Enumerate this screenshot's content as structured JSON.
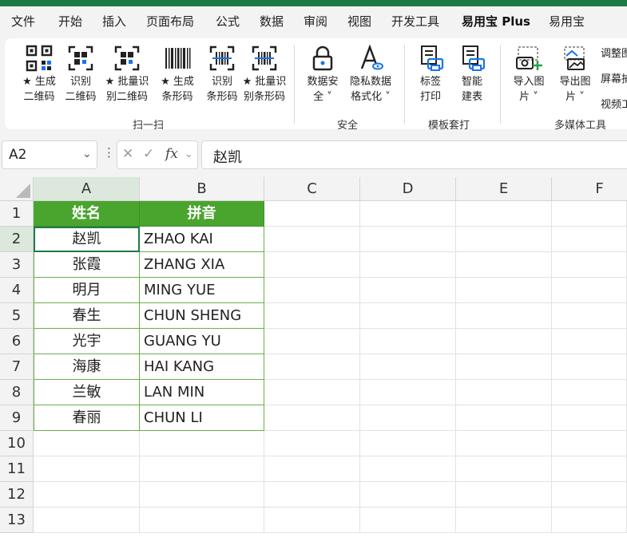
{
  "menu": {
    "items": [
      {
        "id": "file",
        "label": "文件"
      },
      {
        "id": "start",
        "label": "开始"
      },
      {
        "id": "insert",
        "label": "插入"
      },
      {
        "id": "layout",
        "label": "页面布局"
      },
      {
        "id": "formula",
        "label": "公式"
      },
      {
        "id": "data",
        "label": "数据"
      },
      {
        "id": "review",
        "label": "审阅"
      },
      {
        "id": "view",
        "label": "视图"
      },
      {
        "id": "dev",
        "label": "开发工具"
      },
      {
        "id": "easyplus",
        "label": "易用宝 Plus",
        "active": true
      },
      {
        "id": "easy",
        "label": "易用宝"
      }
    ]
  },
  "ribbon": {
    "scan": {
      "group_label": "扫一扫",
      "buttons": [
        {
          "l1": "★ 生成",
          "l2": "二维码",
          "icon": "qr-generate-icon"
        },
        {
          "l1": "识别",
          "l2": "二维码",
          "icon": "qr-scan-icon"
        },
        {
          "l1": "★ 批量识",
          "l2": "别二维码",
          "icon": "qr-batch-icon"
        },
        {
          "l1": "★ 生成",
          "l2": "条形码",
          "icon": "barcode-generate-icon"
        },
        {
          "l1": "识别",
          "l2": "条形码",
          "icon": "barcode-scan-icon"
        },
        {
          "l1": "★ 批量识",
          "l2": "别条形码",
          "icon": "barcode-batch-icon"
        }
      ]
    },
    "security": {
      "group_label": "安全",
      "buttons": [
        {
          "l1": "数据安",
          "l2": "全 ˅",
          "icon": "lock-icon"
        },
        {
          "l1": "隐私数据",
          "l2": "格式化 ˅",
          "icon": "privacy-format-icon"
        }
      ]
    },
    "template": {
      "group_label": "模板套打",
      "buttons": [
        {
          "l1": "标签",
          "l2": "打印",
          "icon": "label-print-icon"
        },
        {
          "l1": "智能",
          "l2": "建表",
          "icon": "smart-table-icon"
        }
      ]
    },
    "media": {
      "group_label": "多媒体工具",
      "buttons": [
        {
          "l1": "导入图",
          "l2": "片 ˅",
          "icon": "import-image-icon"
        },
        {
          "l1": "导出图",
          "l2": "片 ˅",
          "icon": "export-image-icon"
        }
      ],
      "side_items": [
        "调整图",
        "屏幕捕",
        "视频工"
      ]
    }
  },
  "formula_bar": {
    "cell_ref": "A2",
    "fx": "fx",
    "value": "赵凯"
  },
  "sheet": {
    "columns": [
      "A",
      "B",
      "C",
      "D",
      "E",
      "F"
    ],
    "rows": [
      "1",
      "2",
      "3",
      "4",
      "5",
      "6",
      "7",
      "8",
      "9",
      "10",
      "11",
      "12",
      "13"
    ],
    "header": {
      "name": "姓名",
      "pinyin": "拼音"
    },
    "data": [
      {
        "name": "赵凯",
        "pinyin": "ZHAO KAI"
      },
      {
        "name": "张霞",
        "pinyin": "ZHANG XIA"
      },
      {
        "name": "明月",
        "pinyin": "MING YUE"
      },
      {
        "name": "春生",
        "pinyin": "CHUN SHENG"
      },
      {
        "name": "光宇",
        "pinyin": "GUANG YU"
      },
      {
        "name": "海康",
        "pinyin": "HAI KANG"
      },
      {
        "name": "兰敏",
        "pinyin": "LAN MIN"
      },
      {
        "name": "春丽",
        "pinyin": "CHUN LI"
      }
    ]
  },
  "colors": {
    "accent": "#1e7a45",
    "header_fill": "#4aa52f",
    "table_border": "#6ab04c"
  }
}
